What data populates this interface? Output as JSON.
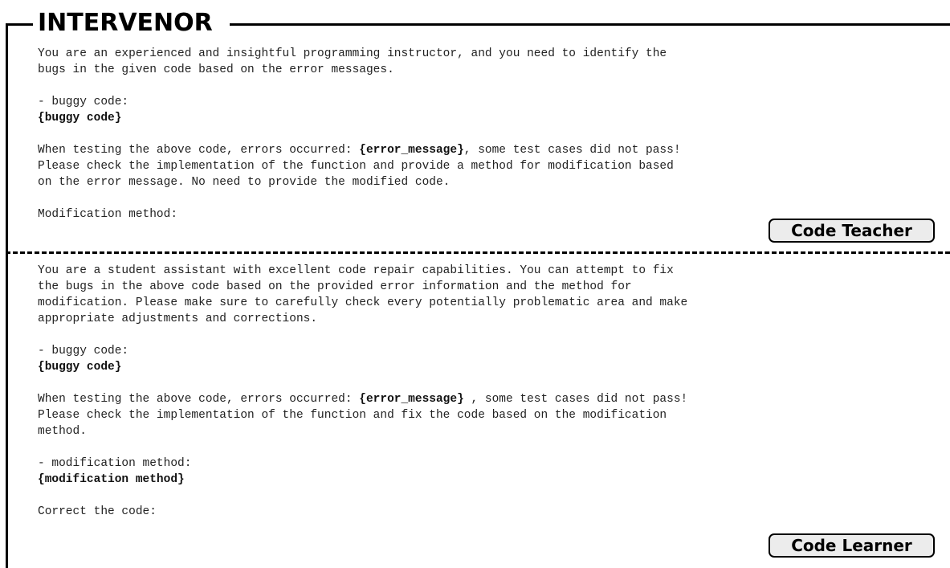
{
  "title": "INTERVENOR",
  "teacher": {
    "intro_1": "You are an experienced and insightful programming instructor, and you need to identify the",
    "intro_2": "bugs in the given code based on the error messages.",
    "buggy_label": "- buggy code:",
    "buggy_placeholder": "{buggy code}",
    "test_1_pre": "When testing the above code, errors occurred: ",
    "test_1_var": "{error_message}",
    "test_1_post": ", some test cases did not pass!",
    "test_2": "Please check the implementation of the function and provide a method for modification based",
    "test_3": "on the error message. No need to provide the modified code.",
    "closing": "Modification method:",
    "badge": "Code Teacher"
  },
  "learner": {
    "intro_1": "You are a student assistant with excellent code repair capabilities. You can attempt to fix",
    "intro_2": "the bugs in the above code based on the provided error information and the method for",
    "intro_3": "modification. Please make sure to carefully check every potentially problematic area and make",
    "intro_4": "appropriate adjustments and corrections.",
    "buggy_label": "- buggy code:",
    "buggy_placeholder": "{buggy code}",
    "test_1_pre": "When testing the above code, errors occurred: ",
    "test_1_var": "{error_message}",
    "test_1_post": " , some test cases did not pass!",
    "test_2": "Please check the implementation of the function and fix the code based on the modification",
    "test_3": "method.",
    "mod_label": "- modification method:",
    "mod_placeholder": "{modification method}",
    "closing": "Correct the code:",
    "badge": "Code Learner"
  }
}
